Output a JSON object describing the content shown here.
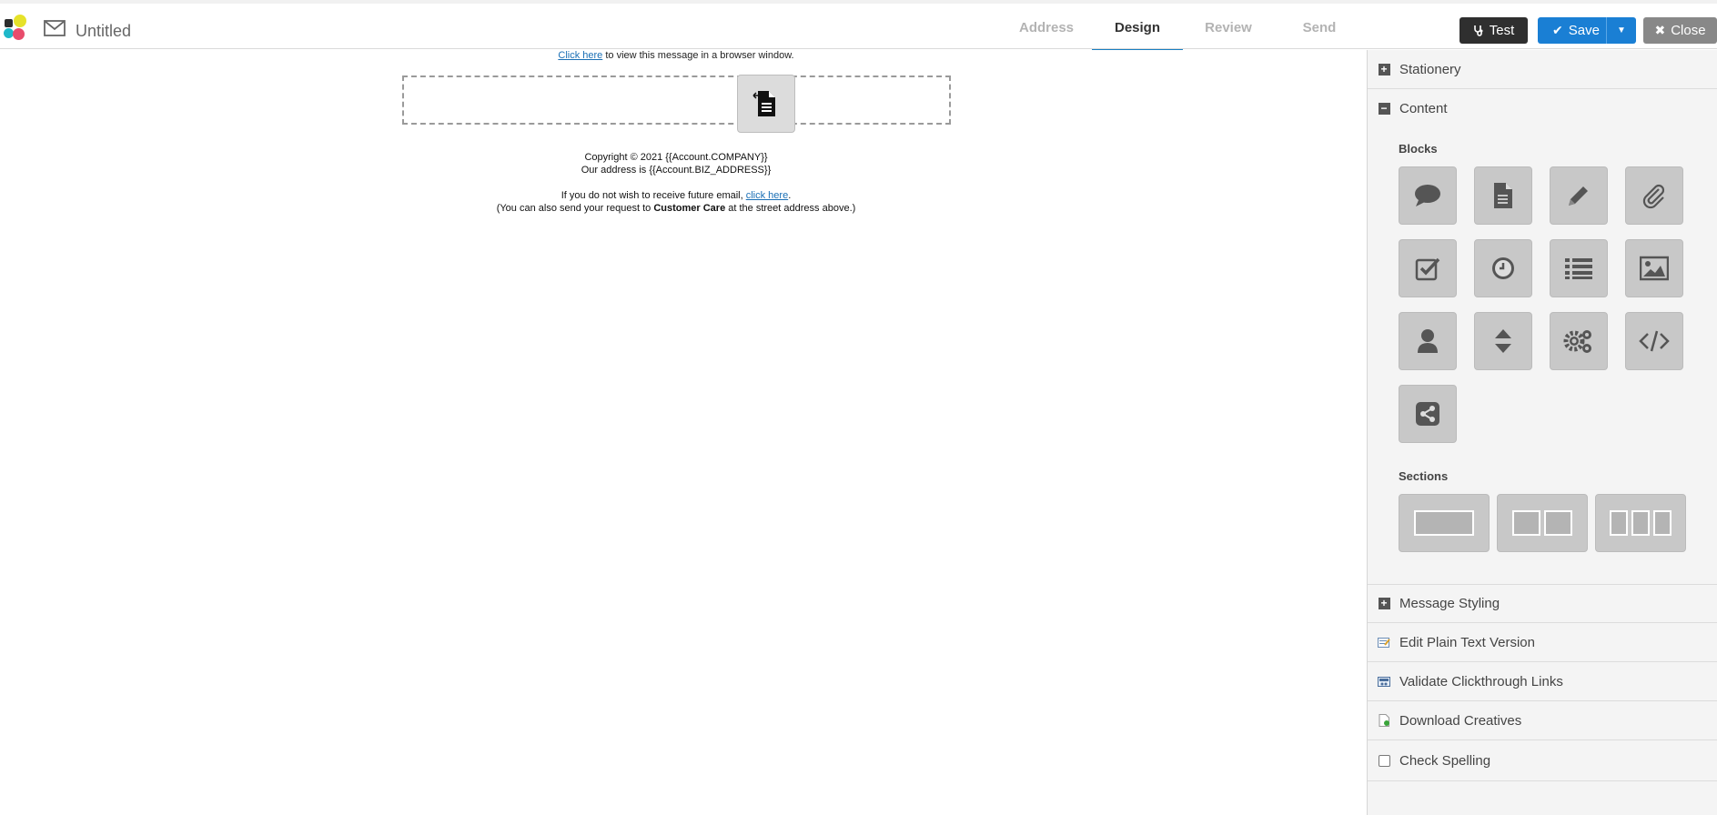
{
  "header": {
    "title": "Untitled",
    "steps": [
      "Address",
      "Design",
      "Review",
      "Send"
    ],
    "active_step": "Design",
    "test_label": "Test",
    "save_label": "Save",
    "close_label": "Close"
  },
  "message": {
    "browser_link": "Click here",
    "browser_text": " to view this message in a browser window.",
    "copyright": "Copyright © 2021 {{Account.COMPANY}}",
    "address": "Our address is {{Account.BIZ_ADDRESS}}",
    "unsub_prefix": "If you do not wish to receive future email, ",
    "unsub_link": "click here",
    "unsub_suffix": ".",
    "request_prefix": "(You can also send your request to ",
    "request_bold": "Customer Care",
    "request_suffix": " at the street address above.)"
  },
  "panel": {
    "stationery": "Stationery",
    "content": "Content",
    "blocks_heading": "Blocks",
    "sections_heading": "Sections",
    "message_styling": "Message Styling",
    "edit_plain_text": "Edit Plain Text Version",
    "validate_links": "Validate Clickthrough Links",
    "download_creatives": "Download Creatives",
    "check_spelling": "Check Spelling"
  },
  "blocks": [
    {
      "icon": "speech-bubble-icon"
    },
    {
      "icon": "document-icon"
    },
    {
      "icon": "pencil-icon"
    },
    {
      "icon": "paperclip-icon"
    },
    {
      "icon": "checkbox-icon"
    },
    {
      "icon": "clock-icon"
    },
    {
      "icon": "list-icon"
    },
    {
      "icon": "image-icon"
    },
    {
      "icon": "person-icon"
    },
    {
      "icon": "spacer-icon"
    },
    {
      "icon": "gears-icon"
    },
    {
      "icon": "code-icon"
    },
    {
      "icon": "share-icon"
    }
  ],
  "sections": [
    {
      "icon": "one-column-icon",
      "columns": 1
    },
    {
      "icon": "two-column-icon",
      "columns": 2
    },
    {
      "icon": "three-column-icon",
      "columns": 3
    }
  ],
  "colors": {
    "accent": "#1a7fc1",
    "save_button": "#1a7fd4",
    "test_button": "#2f2f2f",
    "close_button": "#888888"
  }
}
